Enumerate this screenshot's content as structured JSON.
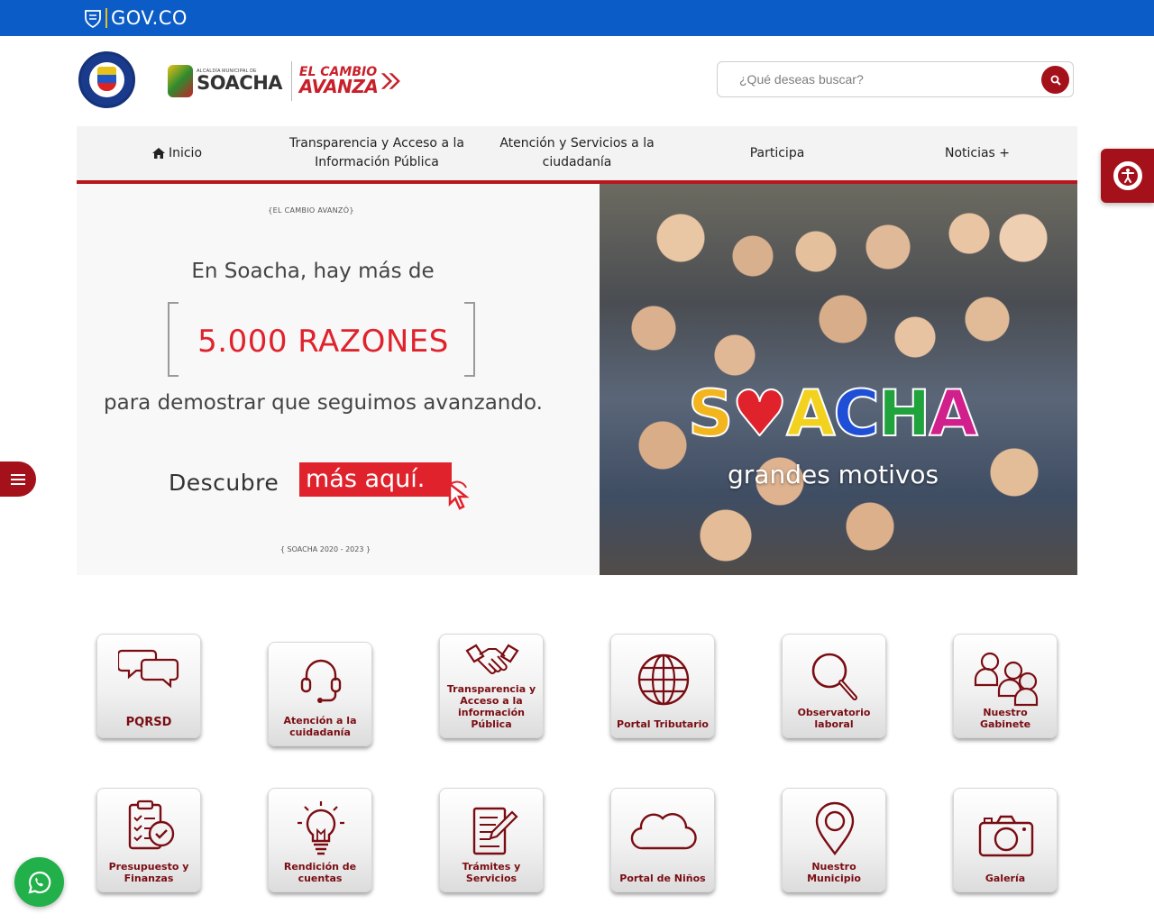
{
  "govbar": {
    "brand": "GOV.CO"
  },
  "header": {
    "soacha_small": "ALCALDÍA MUNICIPAL DE",
    "soacha_big": "SOACHA",
    "cambio_line1": "EL CAMBIO",
    "cambio_line2": "AVANZA"
  },
  "search": {
    "placeholder": "¿Qué deseas buscar?"
  },
  "nav": {
    "items": [
      {
        "label": "Inicio"
      },
      {
        "label": "Transparencia y Acceso a la Información Pública"
      },
      {
        "label": "Atención y Servicios a la ciudadanía"
      },
      {
        "label": "Participa"
      },
      {
        "label": "Noticias +"
      }
    ]
  },
  "banner": {
    "top_tag": "{EL CAMBIO AVANZÓ}",
    "line1": "En Soacha, hay más de",
    "highlight": "5.000 RAZONES",
    "line3": "para demostrar que seguimos avanzando.",
    "descubre": "Descubre",
    "cta": "más aquí.",
    "bottom_tag": "{ SOACHA 2020 - 2023 }",
    "word_letters": [
      "S",
      "♥",
      "A",
      "C",
      "H",
      "A"
    ],
    "word_colors": [
      "#f2b51e",
      "#e0222c",
      "#f2d21e",
      "#1f4fd6",
      "#20a33c",
      "#d11f8c"
    ],
    "subtitle": "grandes motivos"
  },
  "tiles": [
    {
      "label": "PQRSD",
      "icon": "chat-bubbles-icon"
    },
    {
      "label": "Atención a la cuidadanía",
      "icon": "headset-icon"
    },
    {
      "label": "Transparencia y Acceso a la información Pública",
      "icon": "handshake-icon"
    },
    {
      "label": "Portal Tributario",
      "icon": "globe-icon"
    },
    {
      "label": "Observatorio laboral",
      "icon": "magnifier-icon"
    },
    {
      "label": "Nuestro Gabinete",
      "icon": "people-icon"
    },
    {
      "label": "Presupuesto y Finanzas",
      "icon": "clipboard-check-icon"
    },
    {
      "label": "Rendición de cuentas",
      "icon": "lightbulb-icon"
    },
    {
      "label": "Trámites y Servicios",
      "icon": "document-pen-icon"
    },
    {
      "label": "Portal de Niños",
      "icon": "cloud-icon"
    },
    {
      "label": "Nuestro Municipio",
      "icon": "map-pin-icon"
    },
    {
      "label": "Galería",
      "icon": "camera-icon"
    }
  ],
  "colors": {
    "govbar": "#0b5cc6",
    "brand_red": "#a5111a",
    "tile_text": "#7a0d13",
    "whatsapp": "#21b04a"
  }
}
